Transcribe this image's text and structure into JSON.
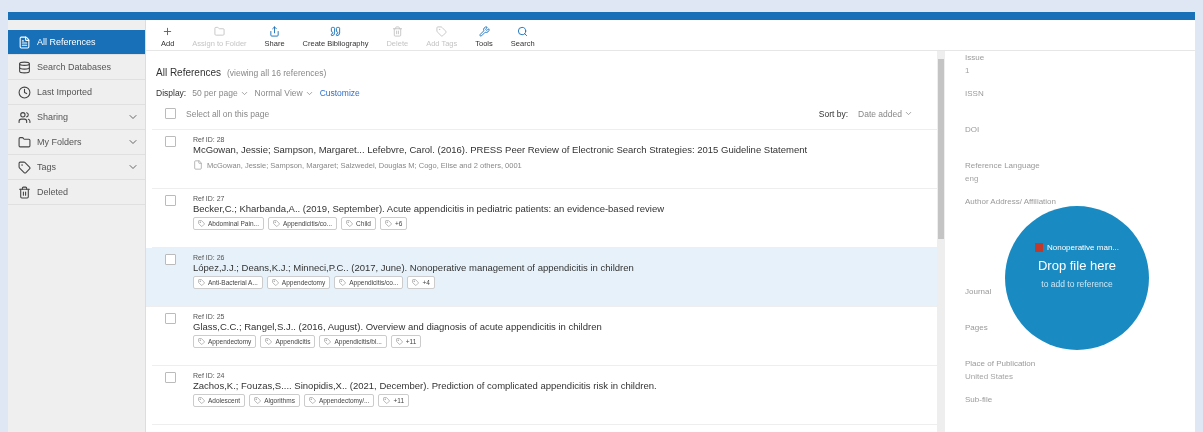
{
  "sidebar": {
    "items": [
      {
        "label": "All References",
        "selected": true,
        "expandable": false
      },
      {
        "label": "Search Databases",
        "selected": false,
        "expandable": false
      },
      {
        "label": "Last Imported",
        "selected": false,
        "expandable": false
      },
      {
        "label": "Sharing",
        "selected": false,
        "expandable": true
      },
      {
        "label": "My Folders",
        "selected": false,
        "expandable": true
      },
      {
        "label": "Tags",
        "selected": false,
        "expandable": true
      },
      {
        "label": "Deleted",
        "selected": false,
        "expandable": false
      }
    ]
  },
  "toolbar": [
    {
      "label": "Add",
      "disabled": false
    },
    {
      "label": "Assign to Folder",
      "disabled": true
    },
    {
      "label": "Share",
      "disabled": false
    },
    {
      "label": "Create Bibliography",
      "disabled": false
    },
    {
      "label": "Delete",
      "disabled": true
    },
    {
      "label": "Add Tags",
      "disabled": true
    },
    {
      "label": "Tools",
      "disabled": false
    },
    {
      "label": "Search",
      "disabled": false
    }
  ],
  "list": {
    "title": "All References",
    "subtitle": "(viewing all 16 references)",
    "display_label": "Display:",
    "per_page": "50 per page",
    "view": "Normal View",
    "customize": "Customize",
    "select_all": "Select all on this page",
    "select_all_checked": false,
    "sort_label": "Sort by:",
    "sort_value": "Date added"
  },
  "references": [
    {
      "ref_id": "Ref ID: 28",
      "citation": "McGowan, Jessie; Sampson, Margaret... Lefebvre, Carol. (2016). PRESS Peer Review of Electronic Search Strategies: 2015 Guideline Statement",
      "selected": false,
      "checked": false,
      "attachment": "McGowan, Jessie; Sampson, Margaret; Salzwedel, Douglas M; Cogo, Elise and 2 others, 0001"
    },
    {
      "ref_id": "Ref ID: 27",
      "citation": "Becker,C.; Kharbanda,A.. (2019, September). Acute appendicitis in pediatric patients: an evidence-based review",
      "selected": false,
      "checked": false,
      "tags": [
        "Abdominal Pain...",
        "Appendicitis/co...",
        "Child",
        "+6"
      ]
    },
    {
      "ref_id": "Ref ID: 26",
      "citation": "López,J.J.; Deans,K.J.; Minneci,P.C.. (2017, June). Nonoperative management of appendicitis in children",
      "selected": true,
      "checked": false,
      "tags": [
        "Anti-Bacterial A...",
        "Appendectomy",
        "Appendicitis/co...",
        "+4"
      ]
    },
    {
      "ref_id": "Ref ID: 25",
      "citation": "Glass,C.C.; Rangel,S.J.. (2016, August). Overview and diagnosis of acute appendicitis in children",
      "selected": false,
      "checked": false,
      "tags": [
        "Appendectomy",
        "Appendicitis",
        "Appendicitis/bl...",
        "+11"
      ]
    },
    {
      "ref_id": "Ref ID: 24",
      "citation": "Zachos,K.; Fouzas,S.... Sinopidis,X.. (2021, December). Prediction of complicated appendicitis risk in children.",
      "selected": false,
      "checked": false,
      "tags": [
        "Adolescent",
        "Algorithms",
        "Appendectomy/...",
        "+11"
      ]
    }
  ],
  "details": [
    {
      "label": "Issue",
      "value": "1"
    },
    {
      "label": "ISSN"
    },
    {
      "label": "DOI"
    },
    {
      "label": "Reference Language",
      "value": "eng"
    },
    {
      "label": "Author Address/ Affiliation"
    },
    {
      "label": "Journal"
    },
    {
      "label": "Pages"
    },
    {
      "label": "Place of Publication",
      "value": "United States"
    },
    {
      "label": "Sub-file"
    }
  ],
  "drop": {
    "file_name": "Nonoperative man...",
    "title": "Drop file here",
    "subtitle": "to add to reference"
  }
}
